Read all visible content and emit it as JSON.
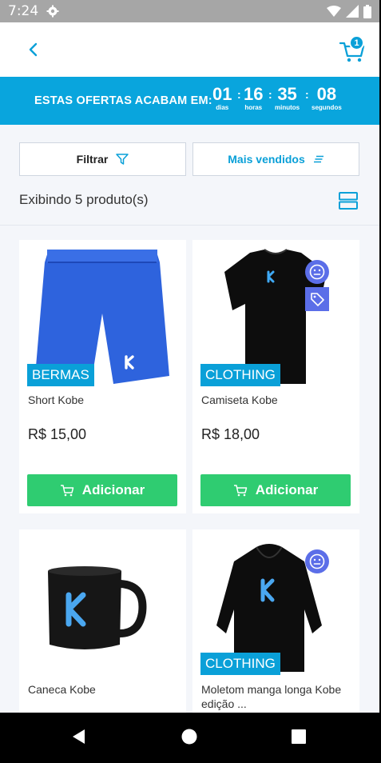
{
  "status_bar": {
    "time": "7:24"
  },
  "header": {
    "cart_count": "1"
  },
  "offer": {
    "label": "ESTAS OFERTAS ACABAM EM:",
    "countdown": [
      {
        "value": "01",
        "unit": "dias"
      },
      {
        "value": "16",
        "unit": "horas"
      },
      {
        "value": "35",
        "unit": "minutos"
      },
      {
        "value": "08",
        "unit": "segundos"
      }
    ]
  },
  "toolbar": {
    "filter_label": "Filtrar",
    "sort_label": "Mais vendidos",
    "result_count": "Exibindo 5 produto(s)"
  },
  "products": [
    {
      "name": "Short Kobe",
      "category": "BERMAS",
      "price": "R$ 15,00",
      "add_label": "Adicionar"
    },
    {
      "name": "Camiseta Kobe",
      "category": "CLOTHING",
      "price": "R$ 18,00",
      "add_label": "Adicionar"
    },
    {
      "name": "Caneca Kobe"
    },
    {
      "name": "Moletom manga longa Kobe edição ...",
      "category": "CLOTHING"
    }
  ],
  "colors": {
    "accent": "#0aa0d8",
    "add_button": "#2fcc71",
    "badge": "#5b6ee8",
    "background": "#f4f6fa"
  },
  "icons": [
    "back-arrow",
    "cart",
    "filter-funnel",
    "sort-lines",
    "grid-toggle",
    "emoji-face",
    "price-tag",
    "cart-add"
  ]
}
